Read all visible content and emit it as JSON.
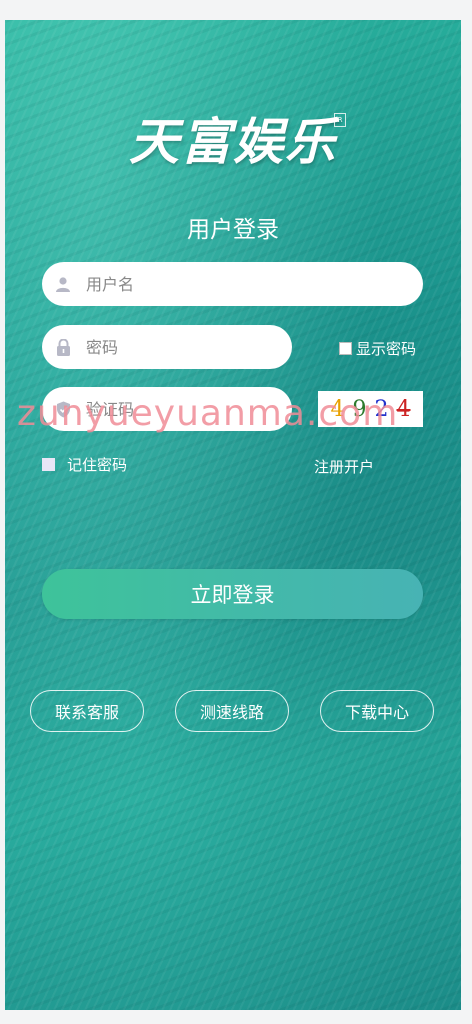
{
  "brand": {
    "logo_text": "天富娱乐",
    "trademark": "R"
  },
  "form": {
    "title": "用户登录",
    "username_placeholder": "用户名",
    "password_placeholder": "密码",
    "show_password_label": "显示密码",
    "captcha_placeholder": "验证码",
    "captcha_digits": [
      "4",
      "9",
      "2",
      "4"
    ],
    "captcha_colors": [
      "#e8a000",
      "#2d7a2d",
      "#2233cc",
      "#cc2222"
    ],
    "remember_label": "记住密码",
    "register_label": "注册开户",
    "login_button": "立即登录"
  },
  "links": {
    "contact": "联系客服",
    "speed_test": "测速线路",
    "download": "下载中心"
  },
  "watermark": "zunyueyuanma.com",
  "icons": {
    "user": "user-icon",
    "lock": "lock-icon",
    "shield": "shield-icon"
  }
}
